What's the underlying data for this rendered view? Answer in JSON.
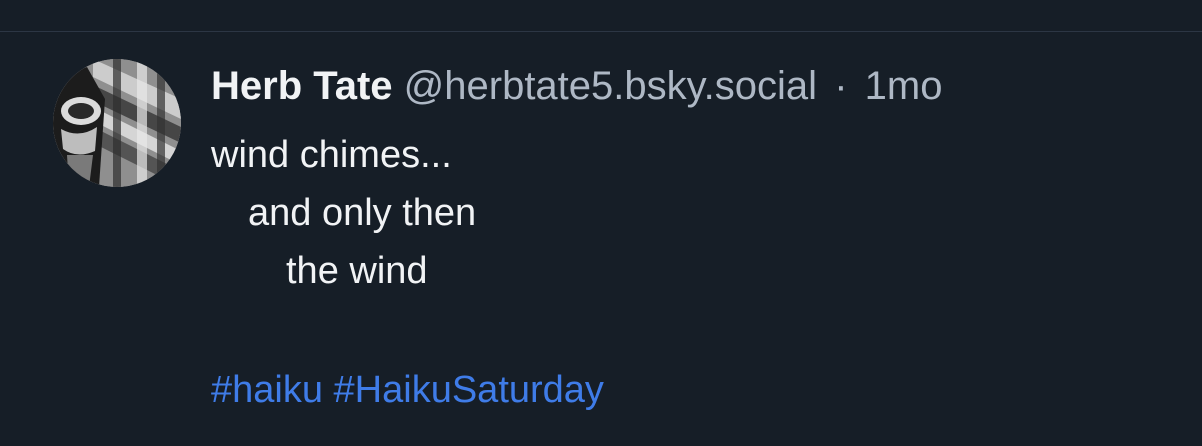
{
  "post": {
    "author": {
      "display_name": "Herb Tate",
      "handle": "@herbtate5.bsky.social",
      "avatar_icon": "user-avatar-photo"
    },
    "separator": "·",
    "timestamp": "1mo",
    "text_lines": [
      "wind chimes...",
      "and only then",
      "the wind"
    ],
    "hashtags": [
      "#haiku",
      "#HaikuSaturday"
    ]
  },
  "colors": {
    "background": "#161e27",
    "divider": "#2c3644",
    "primary_text": "#f1f3f5",
    "secondary_text": "#aeb8c5",
    "link": "#3f7ce8"
  }
}
